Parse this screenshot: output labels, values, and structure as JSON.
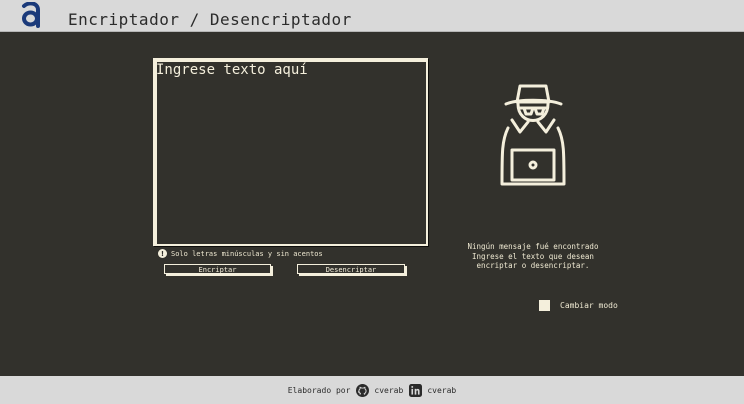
{
  "header": {
    "title": "Encriptador / Desencriptador"
  },
  "input": {
    "placeholder": "Ingrese texto aquí"
  },
  "hint": {
    "text": "Solo letras minúsculas y sin acentos"
  },
  "buttons": {
    "encrypt_label": "Encriptar",
    "decrypt_label": "Desencriptar"
  },
  "output": {
    "line1": "Ningún mensaje fué encontrado",
    "line2": "Ingrese el texto que desean",
    "line3": "encriptar o desencriptar."
  },
  "mode_toggle": {
    "label": "Cambiar modo"
  },
  "footer": {
    "credit_label": "Elaborado por",
    "github_user": "cverab",
    "linkedin_user": "cverab"
  },
  "colors": {
    "background": "#32312c",
    "foreground": "#f4efdc",
    "bar": "#d9d9d9",
    "logo": "#1b3a7a"
  }
}
